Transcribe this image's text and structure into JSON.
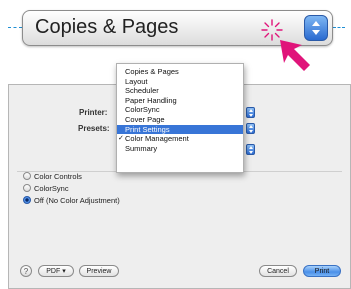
{
  "callout": {
    "popup_label": "Copies & Pages"
  },
  "dialog": {
    "printer_label": "Printer:",
    "presets_label": "Presets:",
    "color_options": [
      {
        "label": "Color Controls",
        "selected": false
      },
      {
        "label": "ColorSync",
        "selected": false
      },
      {
        "label": "Off (No Color Adjustment)",
        "selected": true
      }
    ],
    "help_label": "?",
    "pdf_label": "PDF ▾",
    "preview_label": "Preview",
    "cancel_label": "Cancel",
    "print_label": "Print"
  },
  "menu": {
    "items": [
      {
        "label": "Copies & Pages",
        "checked": false,
        "highlighted": false
      },
      {
        "label": "Layout",
        "checked": false,
        "highlighted": false
      },
      {
        "label": "Scheduler",
        "checked": false,
        "highlighted": false
      },
      {
        "label": "Paper Handling",
        "checked": false,
        "highlighted": false
      },
      {
        "label": "ColorSync",
        "checked": false,
        "highlighted": false
      },
      {
        "label": "Cover Page",
        "checked": false,
        "highlighted": false
      },
      {
        "label": "Print Settings",
        "checked": false,
        "highlighted": true
      },
      {
        "label": "Color Management",
        "checked": true,
        "highlighted": false
      },
      {
        "label": "Summary",
        "checked": false,
        "highlighted": false
      }
    ],
    "check_glyph": "✓"
  },
  "colors": {
    "accent": "#3875d7",
    "callout_dash": "#1f8fd4",
    "cursor": "#e0147a"
  },
  "icons": [
    "stepper-icon",
    "click-burst-icon",
    "arrow-cursor-icon",
    "help-icon"
  ]
}
